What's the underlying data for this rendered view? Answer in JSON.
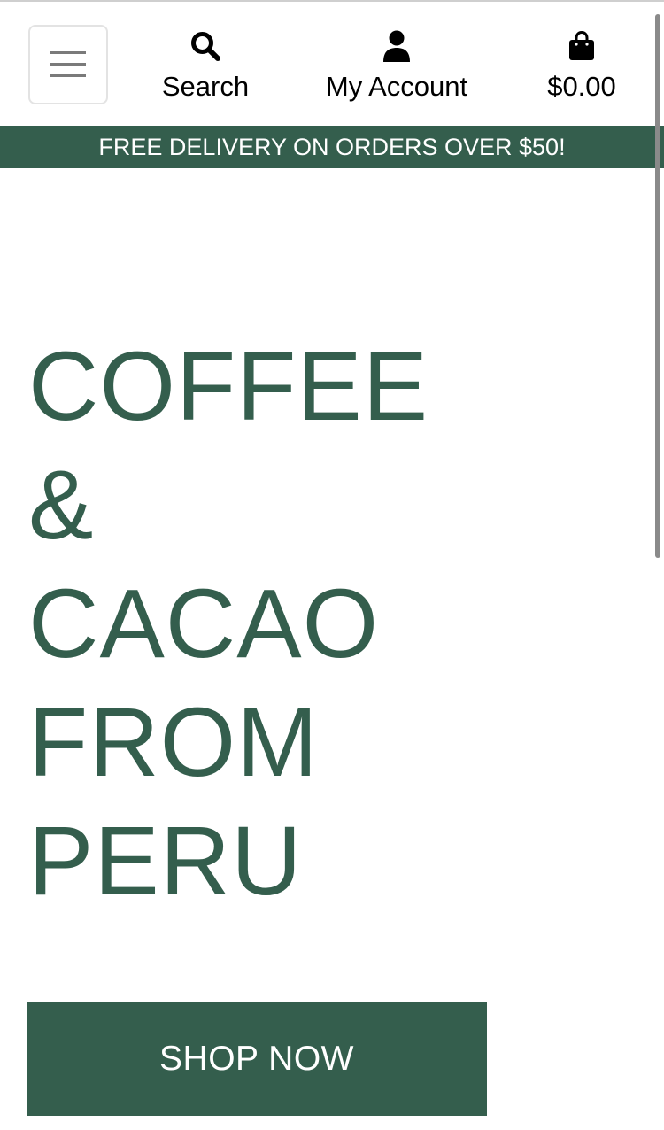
{
  "header": {
    "menu_icon": "hamburger-menu-icon",
    "nav": [
      {
        "label": "Search",
        "icon": "search-icon"
      },
      {
        "label": "My Account",
        "icon": "user-icon"
      },
      {
        "label": "$0.00",
        "icon": "shopping-bag-icon"
      }
    ]
  },
  "promo": {
    "text": "FREE DELIVERY ON ORDERS OVER $50!"
  },
  "hero": {
    "lines": [
      "COFFEE",
      "&",
      "CACAO",
      "FROM",
      "PERU"
    ],
    "cta_label": "SHOP NOW"
  },
  "colors": {
    "brand_green": "#345e4d",
    "banner_text": "#ffffff",
    "nav_text": "#000000"
  }
}
